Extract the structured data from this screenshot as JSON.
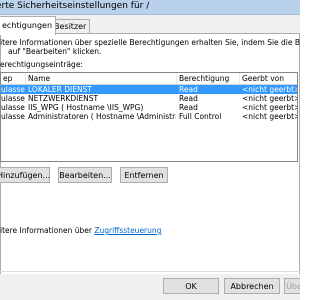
{
  "window": {
    "title": "erte Sicherheitseinstellungen für /"
  },
  "tabs": [
    {
      "label": "echtigungen"
    },
    {
      "label": "Besitzer"
    }
  ],
  "description": {
    "line1": "itere Informationen über spezielle Berechtigungen erhalten Sie, indem Sie die Berechtigung auswähle",
    "line2": "auf \"Bearbeiten\" klicken."
  },
  "permissions_label": "erechtigungseinträge:",
  "table": {
    "columns": [
      "ep",
      "Name",
      "Berechtigung",
      "Geerbt von"
    ],
    "rows": [
      {
        "type": "ulassen",
        "name": "LOKALER DIENST",
        "permission": "Read",
        "inherited": "<nicht geerbt>",
        "selected": true
      },
      {
        "type": "ulassen",
        "name": "NETZWERKDIENST",
        "permission": "Read",
        "inherited": "<nicht geerbt>",
        "selected": false
      },
      {
        "type": "ulassen",
        "name": "IIS_WPG ( Hostname \\IIS_WPG)",
        "permission": "Read",
        "inherited": "<nicht geerbt>",
        "selected": false
      },
      {
        "type": "ulassen",
        "name": "Administratoren ( Hostname \\Administratoren)",
        "permission": "Full Control",
        "inherited": "<nicht geerbt>",
        "selected": false
      }
    ]
  },
  "buttons": {
    "add": "Hinzufügen...",
    "edit": "Bearbeiten...",
    "remove": "Entfernen"
  },
  "info": {
    "prefix": "itere Informationen über ",
    "link": "Zugriffssteuerung"
  },
  "footer": {
    "ok": "OK",
    "cancel": "Abbrechen",
    "apply": "Übernehmen"
  }
}
